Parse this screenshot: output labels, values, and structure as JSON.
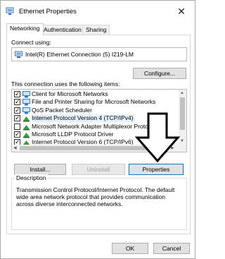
{
  "window": {
    "title": "Ethernet Properties",
    "close_glyph": "✕"
  },
  "tabs": [
    {
      "label": "Networking",
      "active": true
    },
    {
      "label": "Authentication",
      "active": false
    },
    {
      "label": "Sharing",
      "active": false
    }
  ],
  "connect": {
    "label": "Connect using:",
    "adapter": "Intel(R) Ethernet Connection (5) I219-LM",
    "configure_label": "Configure..."
  },
  "items_section": {
    "label": "This connection uses the following items:",
    "items": [
      {
        "label": "Client for Microsoft Networks",
        "checked": true,
        "icon": "network-client-icon",
        "selected": false
      },
      {
        "label": "File and Printer Sharing for Microsoft Networks",
        "checked": true,
        "icon": "network-service-icon",
        "selected": false
      },
      {
        "label": "QoS Packet Scheduler",
        "checked": true,
        "icon": "network-service-icon",
        "selected": false
      },
      {
        "label": "Internet Protocol Version 4 (TCP/IPv4)",
        "checked": true,
        "icon": "protocol-icon",
        "selected": true
      },
      {
        "label": "Microsoft Network Adapter Multiplexor Protocol",
        "checked": false,
        "icon": "protocol-icon",
        "selected": false
      },
      {
        "label": "Microsoft LLDP Protocol Driver",
        "checked": true,
        "icon": "protocol-icon",
        "selected": false
      },
      {
        "label": "Internet Protocol Version 6 (TCP/IPv6)",
        "checked": true,
        "icon": "protocol-icon",
        "selected": false
      }
    ]
  },
  "buttons": {
    "install": "Install...",
    "uninstall": "Uninstall",
    "properties": "Properties",
    "ok": "OK",
    "cancel": "Cancel"
  },
  "description": {
    "legend": "Description",
    "text": "Transmission Control Protocol/Internet Protocol. The default wide area network protocol that provides communication across diverse interconnected networks."
  },
  "colors": {
    "selection": "#e5f1fb",
    "focus_border": "#0078d7",
    "icon_blue": "#2f7fd1",
    "icon_green": "#3a9b3a"
  }
}
